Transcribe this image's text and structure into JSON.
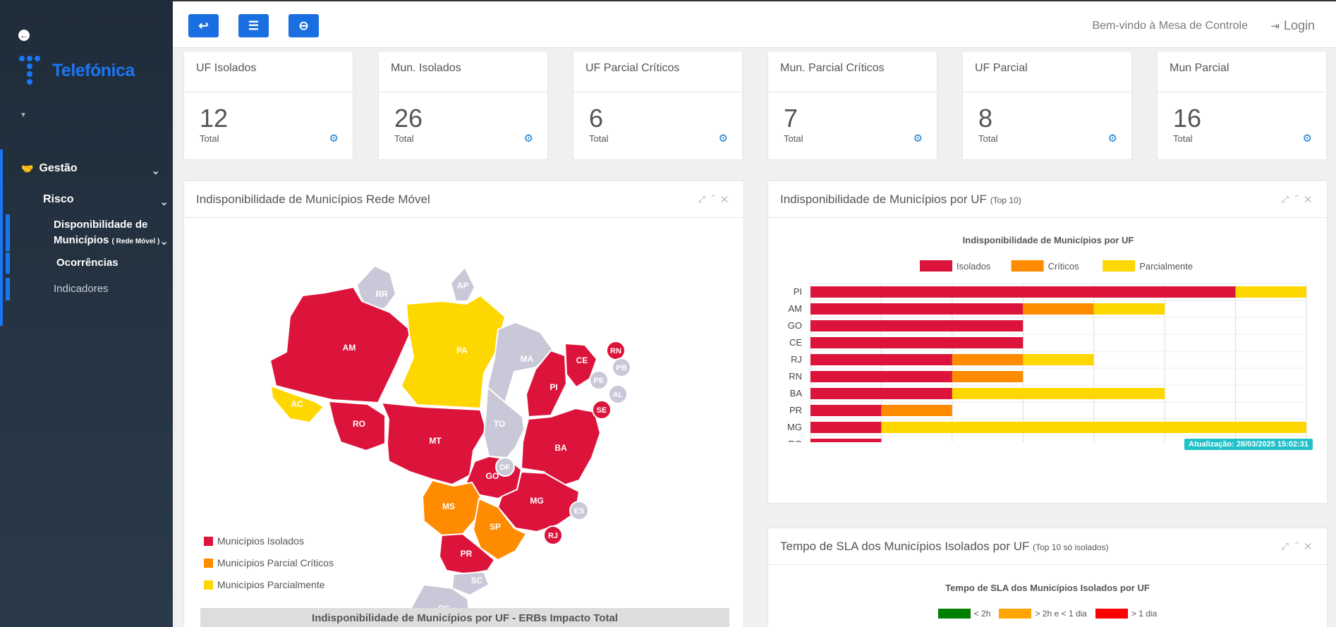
{
  "sidebar": {
    "brand": "Telefónica",
    "menu": {
      "gestao": "Gestão",
      "risco": "Risco",
      "disponibilidade_line1": "Disponibilidade de",
      "disponibilidade_line2": "Municípios",
      "disponibilidade_suffix": "( Rede Móvel )",
      "ocorrencias": "Ocorrências",
      "indicadores": "Indicadores"
    }
  },
  "topbar": {
    "welcome": "Bem-vindo à Mesa de Controle",
    "login": "Login"
  },
  "cards": [
    {
      "title": "UF Isolados",
      "value": "12",
      "label": "Total"
    },
    {
      "title": "Mun. Isolados",
      "value": "26",
      "label": "Total"
    },
    {
      "title": "UF Parcial Críticos",
      "value": "6",
      "label": "Total"
    },
    {
      "title": "Mun. Parcial Críticos",
      "value": "7",
      "label": "Total"
    },
    {
      "title": "UF Parcial",
      "value": "8",
      "label": "Total"
    },
    {
      "title": "Mun Parcial",
      "value": "16",
      "label": "Total"
    }
  ],
  "map_panel": {
    "title": "Indisponibilidade de Municípios Rede Móvel",
    "legend": [
      "Municípios Isolados",
      "Municípios Parcial Críticos",
      "Municípios Parcialmente"
    ],
    "bottom_title": "Indisponibilidade de Municípios por UF - ERBs Impacto Total",
    "states": [
      {
        "uf": "RR",
        "status": "none"
      },
      {
        "uf": "AP",
        "status": "none"
      },
      {
        "uf": "AM",
        "status": "isolado"
      },
      {
        "uf": "PA",
        "status": "parcial"
      },
      {
        "uf": "MA",
        "status": "none"
      },
      {
        "uf": "CE",
        "status": "isolado"
      },
      {
        "uf": "RN",
        "status": "isolado"
      },
      {
        "uf": "PB",
        "status": "none"
      },
      {
        "uf": "PE",
        "status": "none"
      },
      {
        "uf": "AL",
        "status": "none"
      },
      {
        "uf": "SE",
        "status": "isolado"
      },
      {
        "uf": "PI",
        "status": "isolado"
      },
      {
        "uf": "AC",
        "status": "parcial"
      },
      {
        "uf": "RO",
        "status": "isolado"
      },
      {
        "uf": "TO",
        "status": "none"
      },
      {
        "uf": "BA",
        "status": "isolado"
      },
      {
        "uf": "MT",
        "status": "isolado"
      },
      {
        "uf": "DF",
        "status": "none"
      },
      {
        "uf": "GO",
        "status": "isolado"
      },
      {
        "uf": "MG",
        "status": "isolado"
      },
      {
        "uf": "ES",
        "status": "none"
      },
      {
        "uf": "MS",
        "status": "critico"
      },
      {
        "uf": "SP",
        "status": "critico"
      },
      {
        "uf": "RJ",
        "status": "isolado"
      },
      {
        "uf": "PR",
        "status": "isolado"
      },
      {
        "uf": "SC",
        "status": "none"
      },
      {
        "uf": "RS",
        "status": "none"
      }
    ]
  },
  "bar_panel": {
    "title": "Indisponibilidade de Municípios por UF",
    "title_suffix": "(Top 10)",
    "update": "Atualização: 28/03/2025 15:02:31"
  },
  "sla_panel": {
    "title": "Tempo de SLA dos Municípios Isolados por UF",
    "title_suffix": "(Top 10 só isolados)",
    "chart_title": "Tempo de SLA dos Municípios Isolados por UF",
    "legend": [
      {
        "name": "< 2h",
        "color": "#008000"
      },
      {
        "name": "> 2h e < 1 dia",
        "color": "#ffa500"
      },
      {
        "name": "> 1 dia",
        "color": "#ff0000"
      }
    ]
  },
  "chart_data": {
    "type": "bar",
    "orientation": "horizontal",
    "stacked": true,
    "title": "Indisponibilidade de Municípios por UF",
    "categories": [
      "PI",
      "AM",
      "GO",
      "CE",
      "RJ",
      "RN",
      "BA",
      "PR",
      "MG",
      "RO"
    ],
    "series": [
      {
        "name": "Isolados",
        "color": "#dc143c",
        "values": [
          6,
          3,
          3,
          3,
          2,
          2,
          2,
          1,
          1,
          1
        ]
      },
      {
        "name": "Críticos",
        "color": "#ff8c00",
        "values": [
          0,
          1,
          0,
          0,
          1,
          1,
          0,
          1,
          0,
          0
        ]
      },
      {
        "name": "Parcialmente",
        "color": "#ffd700",
        "values": [
          1,
          1,
          0,
          0,
          1,
          0,
          3,
          0,
          6,
          0
        ]
      }
    ],
    "xlim": [
      0,
      7
    ],
    "xticks": [
      "0",
      "1",
      "2",
      "3",
      "4",
      "5",
      "6",
      "7"
    ],
    "legend_position": "top",
    "grid": true
  },
  "colors": {
    "isolado": "#dc143c",
    "critico": "#ff8c00",
    "parcial": "#ffd700",
    "none": "#c8c8d8",
    "accent": "#1a6fe0"
  }
}
